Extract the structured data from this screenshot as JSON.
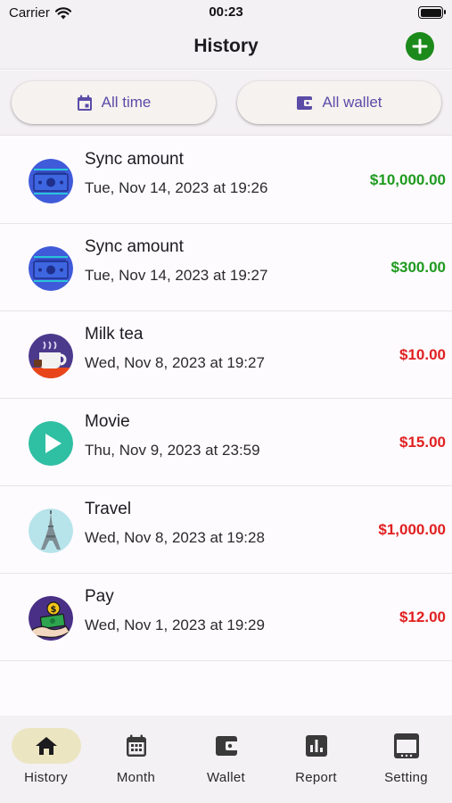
{
  "status_bar": {
    "carrier": "Carrier",
    "time": "00:23"
  },
  "header": {
    "title": "History"
  },
  "filters": {
    "time_label": "All time",
    "wallet_label": "All wallet"
  },
  "colors": {
    "accent": "#5b4ca8",
    "income": "#1e9a1e",
    "expense": "#e02020",
    "add_button": "#1b8a1b"
  },
  "transactions": [
    {
      "name": "Sync amount",
      "date": "Tue, Nov 14, 2023 at 19:26",
      "amount": "$10,000.00",
      "type": "income",
      "icon": "money-icon"
    },
    {
      "name": "Sync amount",
      "date": "Tue, Nov 14, 2023 at 19:27",
      "amount": "$300.00",
      "type": "income",
      "icon": "money-icon"
    },
    {
      "name": "Milk tea",
      "date": "Wed, Nov 8, 2023 at 19:27",
      "amount": "$10.00",
      "type": "expense",
      "icon": "coffee-cup-icon"
    },
    {
      "name": "Movie",
      "date": "Thu, Nov 9, 2023 at 23:59",
      "amount": "$15.00",
      "type": "expense",
      "icon": "play-icon"
    },
    {
      "name": "Travel",
      "date": "Wed, Nov 8, 2023 at 19:28",
      "amount": "$1,000.00",
      "type": "expense",
      "icon": "eiffel-tower-icon"
    },
    {
      "name": "Pay",
      "date": "Wed, Nov 1, 2023 at 19:29",
      "amount": "$12.00",
      "type": "expense",
      "icon": "hand-money-icon"
    }
  ],
  "tabs": [
    {
      "label": "History",
      "icon": "home-icon",
      "active": true
    },
    {
      "label": "Month",
      "icon": "calendar-icon",
      "active": false
    },
    {
      "label": "Wallet",
      "icon": "wallet-icon",
      "active": false
    },
    {
      "label": "Report",
      "icon": "bar-chart-icon",
      "active": false
    },
    {
      "label": "Setting",
      "icon": "settings-icon",
      "active": false
    }
  ]
}
